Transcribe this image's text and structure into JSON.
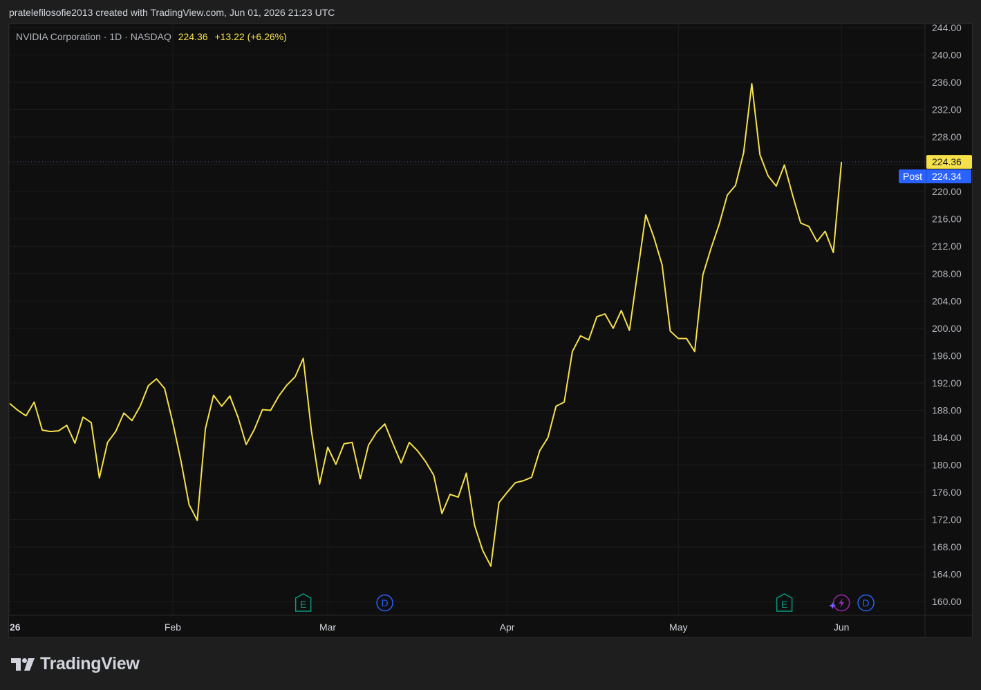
{
  "attribution": "pratelefilosofie2013 created with TradingView.com, Jun 01, 2026 21:23 UTC",
  "legend": {
    "symbol": "NVIDIA Corporation · 1D · NASDAQ",
    "price": "224.36",
    "change": "+13.22 (+6.26%)"
  },
  "brand": {
    "name": "TradingView"
  },
  "colors": {
    "line": "#f7e14b",
    "last_label_bg": "#f7e14b",
    "post_label_bg": "#2962ff",
    "earnings_icon": "#089981",
    "dividend_icon": "#2962ff",
    "split_icon": "#9c27b0"
  },
  "chart_data": {
    "type": "line",
    "title": "NVIDIA Corporation · 1D · NASDAQ",
    "ylim": [
      158,
      244.5
    ],
    "y_ticks": [
      "244.00",
      "240.00",
      "236.00",
      "232.00",
      "228.00",
      "224.00",
      "220.00",
      "216.00",
      "212.00",
      "208.00",
      "204.00",
      "200.00",
      "196.00",
      "192.00",
      "188.00",
      "184.00",
      "180.00",
      "176.00",
      "172.00",
      "168.00",
      "164.00",
      "160.00"
    ],
    "x_labels": [
      {
        "label": "26",
        "index": 0
      },
      {
        "label": "Feb",
        "index": 20
      },
      {
        "label": "Mar",
        "index": 39
      },
      {
        "label": "Apr",
        "index": 61
      },
      {
        "label": "May",
        "index": 82
      },
      {
        "label": "Jun",
        "index": 102
      }
    ],
    "x_count": 114,
    "series": [
      {
        "values": [
          189,
          188,
          187.2,
          189.2,
          185.1,
          184.9,
          185,
          185.8,
          183.2,
          187,
          186.2,
          178.1,
          183.3,
          184.9,
          187.6,
          186.5,
          188.6,
          191.6,
          192.6,
          191.2,
          186.2,
          180.6,
          174.2,
          171.9,
          185.3,
          190.2,
          188.6,
          190.1,
          187,
          183,
          185.2,
          188.1,
          188,
          190.1,
          191.7,
          192.9,
          195.6,
          185,
          177.2,
          182.6,
          180.1,
          183.1,
          183.3,
          178,
          182.9,
          184.8,
          186,
          183.1,
          180.3,
          183.3,
          182.1,
          180.5,
          178.5,
          172.9,
          175.7,
          175.3,
          178.8,
          171.2,
          167.5,
          165.2,
          174.5,
          176,
          177.4,
          177.7,
          178.2,
          182.1,
          184,
          188.6,
          189.2,
          196.6,
          198.9,
          198.3,
          201.7,
          202.1,
          200,
          202.6,
          199.7,
          208.2,
          216.6,
          213.3,
          209.3,
          199.6,
          198.5,
          198.5,
          196.6,
          207.8,
          211.7,
          215.2,
          219.5,
          220.9,
          225.7,
          235.8,
          225.4,
          222.3,
          220.8,
          223.9,
          219.5,
          215.4,
          214.9,
          212.7,
          214.2,
          211.1,
          224.36
        ],
        "last_value": "224.36",
        "post_value": "224.34"
      }
    ],
    "post_label": "Post",
    "events": [
      {
        "type": "earnings",
        "letter": "E",
        "index": 36
      },
      {
        "type": "dividend",
        "letter": "D",
        "index": 46
      },
      {
        "type": "earnings",
        "letter": "E",
        "index": 95
      },
      {
        "type": "split",
        "letter": "⚡",
        "index": 102
      },
      {
        "type": "dividend",
        "letter": "D",
        "index": 105
      }
    ],
    "grid": true
  }
}
